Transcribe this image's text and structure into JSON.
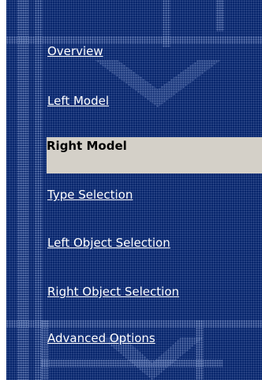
{
  "navigation": {
    "items": [
      {
        "label": "Overview",
        "active": false
      },
      {
        "label": "Left Model",
        "active": false
      },
      {
        "label": "Right Model",
        "active": true
      },
      {
        "label": "Type Selection",
        "active": false
      },
      {
        "label": "Left Object Selection",
        "active": false
      },
      {
        "label": "Right Object Selection",
        "active": false
      },
      {
        "label": "Advanced Options",
        "active": false
      }
    ]
  },
  "colors": {
    "panel_background": "#06246b",
    "active_background": "#d4d0c8",
    "link_text": "#ffffff",
    "active_text": "#000000"
  }
}
